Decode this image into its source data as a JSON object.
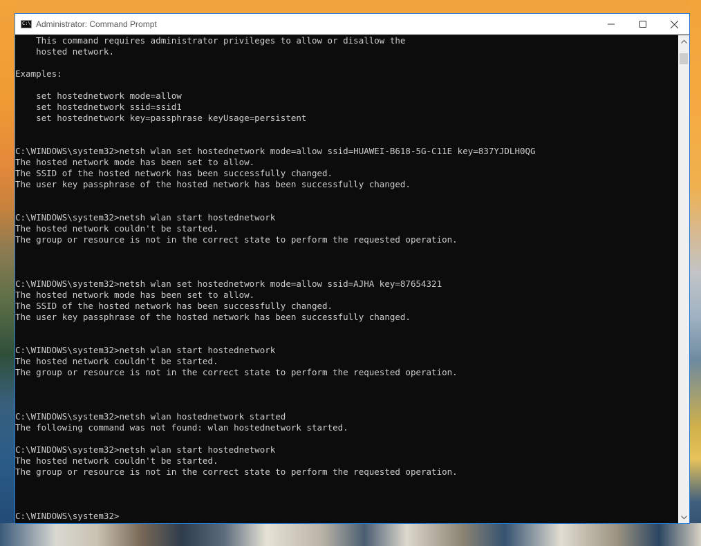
{
  "window": {
    "title": "Administrator: Command Prompt",
    "icon_text": "C:\\_"
  },
  "title_buttons": {
    "minimize_icon": "minimize-icon",
    "maximize_icon": "maximize-icon",
    "close_icon": "close-icon"
  },
  "console": {
    "lines": [
      "    This command requires administrator privileges to allow or disallow the",
      "    hosted network.",
      "",
      "Examples:",
      "",
      "    set hostednetwork mode=allow",
      "    set hostednetwork ssid=ssid1",
      "    set hostednetwork key=passphrase keyUsage=persistent",
      "",
      "",
      "C:\\WINDOWS\\system32>netsh wlan set hostednetwork mode=allow ssid=HUAWEI-B618-5G-C11E key=837YJDLH0QG",
      "The hosted network mode has been set to allow.",
      "The SSID of the hosted network has been successfully changed.",
      "The user key passphrase of the hosted network has been successfully changed.",
      "",
      "",
      "C:\\WINDOWS\\system32>netsh wlan start hostednetwork",
      "The hosted network couldn't be started.",
      "The group or resource is not in the correct state to perform the requested operation.",
      "",
      "",
      "",
      "C:\\WINDOWS\\system32>netsh wlan set hostednetwork mode=allow ssid=AJHA key=87654321",
      "The hosted network mode has been set to allow.",
      "The SSID of the hosted network has been successfully changed.",
      "The user key passphrase of the hosted network has been successfully changed.",
      "",
      "",
      "C:\\WINDOWS\\system32>netsh wlan start hostednetwork",
      "The hosted network couldn't be started.",
      "The group or resource is not in the correct state to perform the requested operation.",
      "",
      "",
      "",
      "C:\\WINDOWS\\system32>netsh wlan hostednetwork started",
      "The following command was not found: wlan hostednetwork started.",
      "",
      "C:\\WINDOWS\\system32>netsh wlan start hostednetwork",
      "The hosted network couldn't be started.",
      "The group or resource is not in the correct state to perform the requested operation.",
      "",
      "",
      "",
      "C:\\WINDOWS\\system32>"
    ]
  },
  "colors": {
    "console_background": "#0c0c0c",
    "console_text": "#cccccc",
    "window_border": "#2b7bd6",
    "titlebar_background": "#ffffff"
  }
}
